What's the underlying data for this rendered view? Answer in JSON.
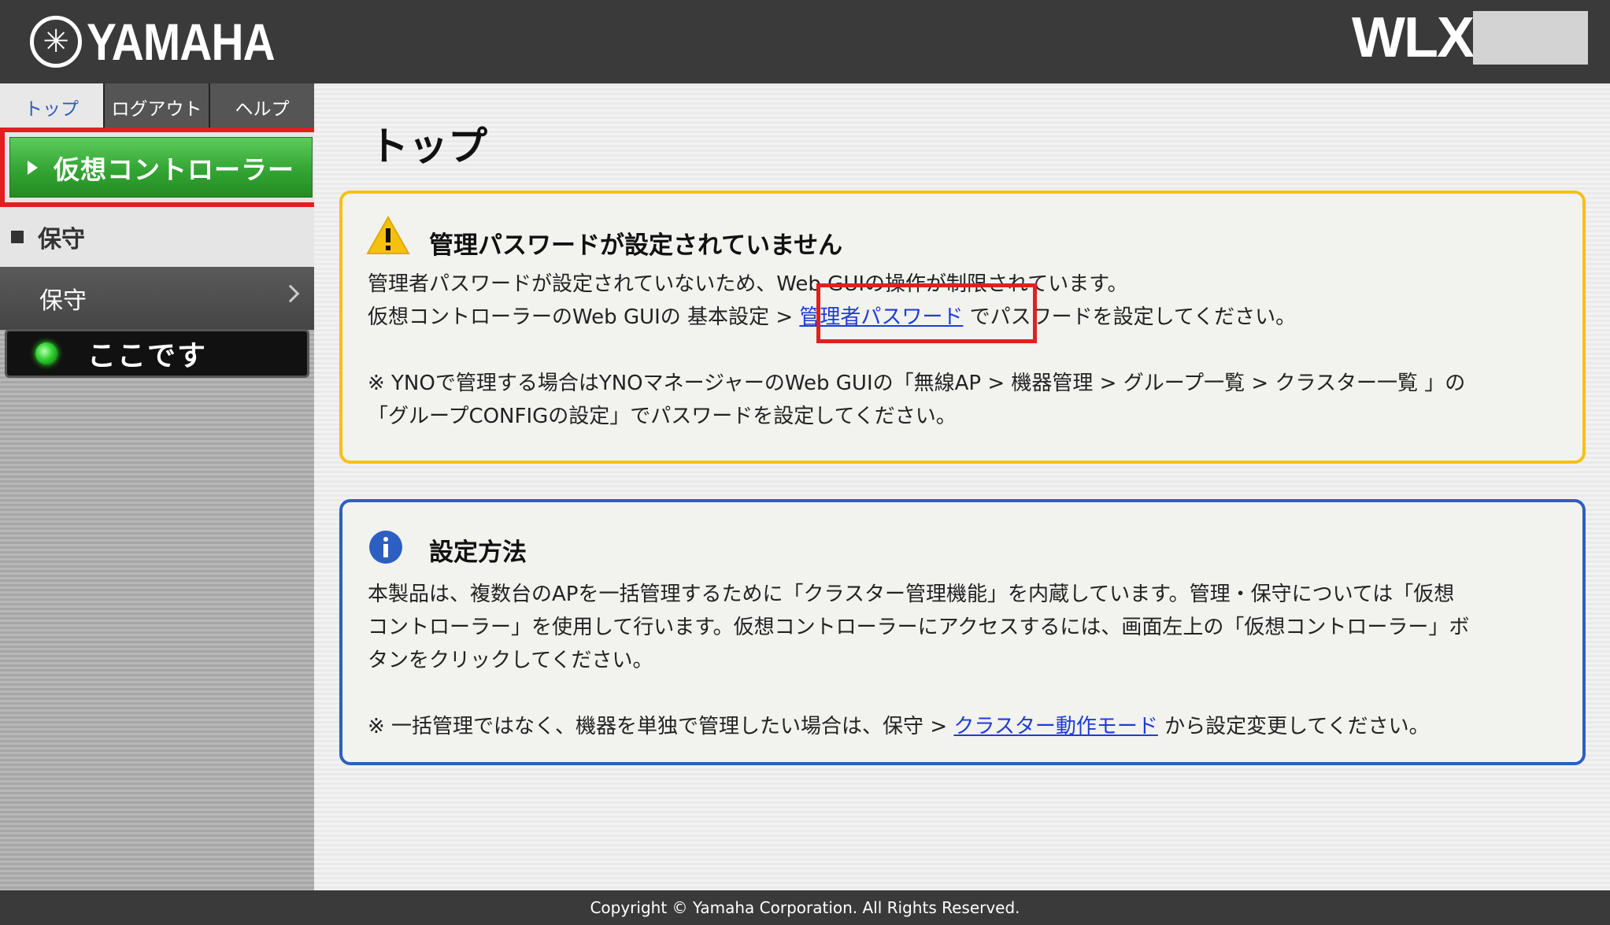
{
  "header": {
    "brand": "YAMAHA",
    "model": "WLX"
  },
  "sidebar": {
    "tabs": [
      {
        "label": "トップ"
      },
      {
        "label": "ログアウト"
      },
      {
        "label": "ヘルプ"
      }
    ],
    "virtual_controller_button": "仮想コントローラー",
    "section_heading": "保守",
    "menu_item": "保守",
    "status_label": "ここです"
  },
  "main": {
    "title": "トップ",
    "warning": {
      "title": "管理パスワードが設定されていません",
      "line1": "管理者パスワードが設定されていないため、Web GUIの操作が制限されています。",
      "line2_pre": "仮想コントローラーのWeb GUIの 基本設定 > ",
      "line2_link": "管理者パスワード",
      "line2_post": " でパスワードを設定してください。",
      "note1": "※ YNOで管理する場合はYNOマネージャーのWeb GUIの「無線AP > 機器管理 > グループ一覧 > クラスター一覧 」の",
      "note2": "「グループCONFIGの設定」でパスワードを設定してください。"
    },
    "info": {
      "title": "設定方法",
      "line1": "本製品は、複数台のAPを一括管理するために「クラスター管理機能」を内蔵しています。管理・保守については「仮想",
      "line2": "コントローラー」を使用して行います。仮想コントローラーにアクセスするには、画面左上の「仮想コントローラー」ボ",
      "line3": "タンをクリックしてください。",
      "note_pre": "※ 一括管理ではなく、機器を単独で管理したい場合は、保守 > ",
      "note_link": "クラスター動作モード",
      "note_post": " から設定変更してください。"
    }
  },
  "footer": {
    "copyright": "Copyright © Yamaha Corporation. All Rights Reserved."
  },
  "colors": {
    "header_bg": "#3a3a3a",
    "highlight_red": "#e02020",
    "vc_green": "#33a533",
    "warning_yellow": "#f5c10f",
    "info_blue": "#2d5fc2",
    "link_blue": "#1f3cd6"
  },
  "icons": [
    "yamaha-emblem-icon",
    "play-triangle-icon",
    "square-bullet-icon",
    "chevron-right-icon",
    "status-led-icon",
    "warning-icon",
    "info-icon"
  ]
}
